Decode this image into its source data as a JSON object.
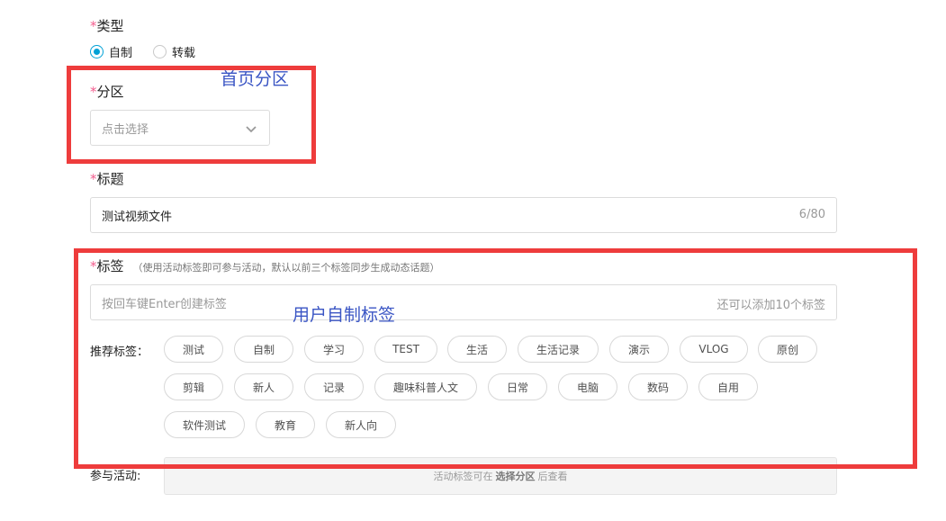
{
  "type_section": {
    "required_mark": "*",
    "label": "类型",
    "options": [
      {
        "label": "自制",
        "checked": true
      },
      {
        "label": "转载",
        "checked": false
      }
    ]
  },
  "partition_section": {
    "required_mark": "*",
    "label": "分区",
    "placeholder": "点击选择"
  },
  "title_section": {
    "required_mark": "*",
    "label": "标题",
    "value": "测试视频文件",
    "counter": "6/80"
  },
  "tags_section": {
    "required_mark": "*",
    "label": "标签",
    "hint": "（使用活动标签即可参与活动，默认以前三个标签同步生成动态话题）",
    "input_placeholder": "按回车键Enter创建标签",
    "remaining": "还可以添加10个标签",
    "recommend_label": "推荐标签：",
    "recommended": [
      "测试",
      "自制",
      "学习",
      "TEST",
      "生活",
      "生活记录",
      "演示",
      "VLOG",
      "原创",
      "剪辑",
      "新人",
      "记录",
      "趣味科普人文",
      "日常",
      "电脑",
      "数码",
      "自用",
      "软件测试",
      "教育",
      "新人向"
    ]
  },
  "activity_section": {
    "label": "参与活动:",
    "text_before": "活动标签可在",
    "text_bold": "选择分区",
    "text_after": "后查看"
  },
  "annotations": {
    "home_partition": "首页分区",
    "user_tags": "用户自制标签",
    "color": "#ee3c3c"
  },
  "accent_color": "#00a1d6",
  "required_color": "#f25d8e"
}
